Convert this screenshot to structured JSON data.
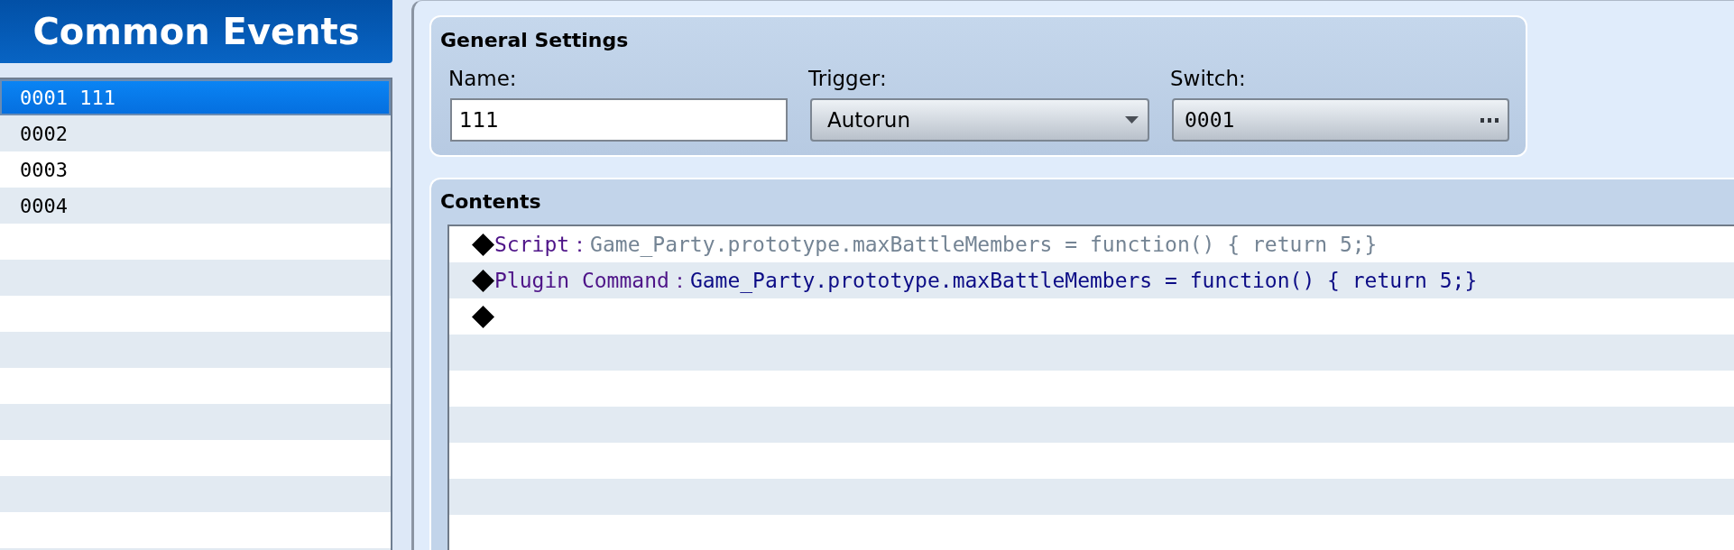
{
  "sidebar": {
    "title": "Common Events",
    "items": [
      {
        "label": "0001 111",
        "selected": true
      },
      {
        "label": "0002",
        "selected": false
      },
      {
        "label": "0003",
        "selected": false
      },
      {
        "label": "0004",
        "selected": false
      }
    ]
  },
  "general_settings": {
    "title": "General Settings",
    "name": {
      "label": "Name:",
      "value": "111"
    },
    "trigger": {
      "label": "Trigger:",
      "value": "Autorun"
    },
    "switch": {
      "label": "Switch:",
      "value": "0001"
    }
  },
  "contents": {
    "title": "Contents",
    "commands": [
      {
        "kind": "script",
        "label": "Script：",
        "text": "Game_Party.prototype.maxBattleMembers = function() { return 5;}"
      },
      {
        "kind": "plugin",
        "label": "Plugin Command：",
        "text": "Game_Party.prototype.maxBattleMembers = function() { return 5;}"
      },
      {
        "kind": "empty"
      }
    ]
  }
}
